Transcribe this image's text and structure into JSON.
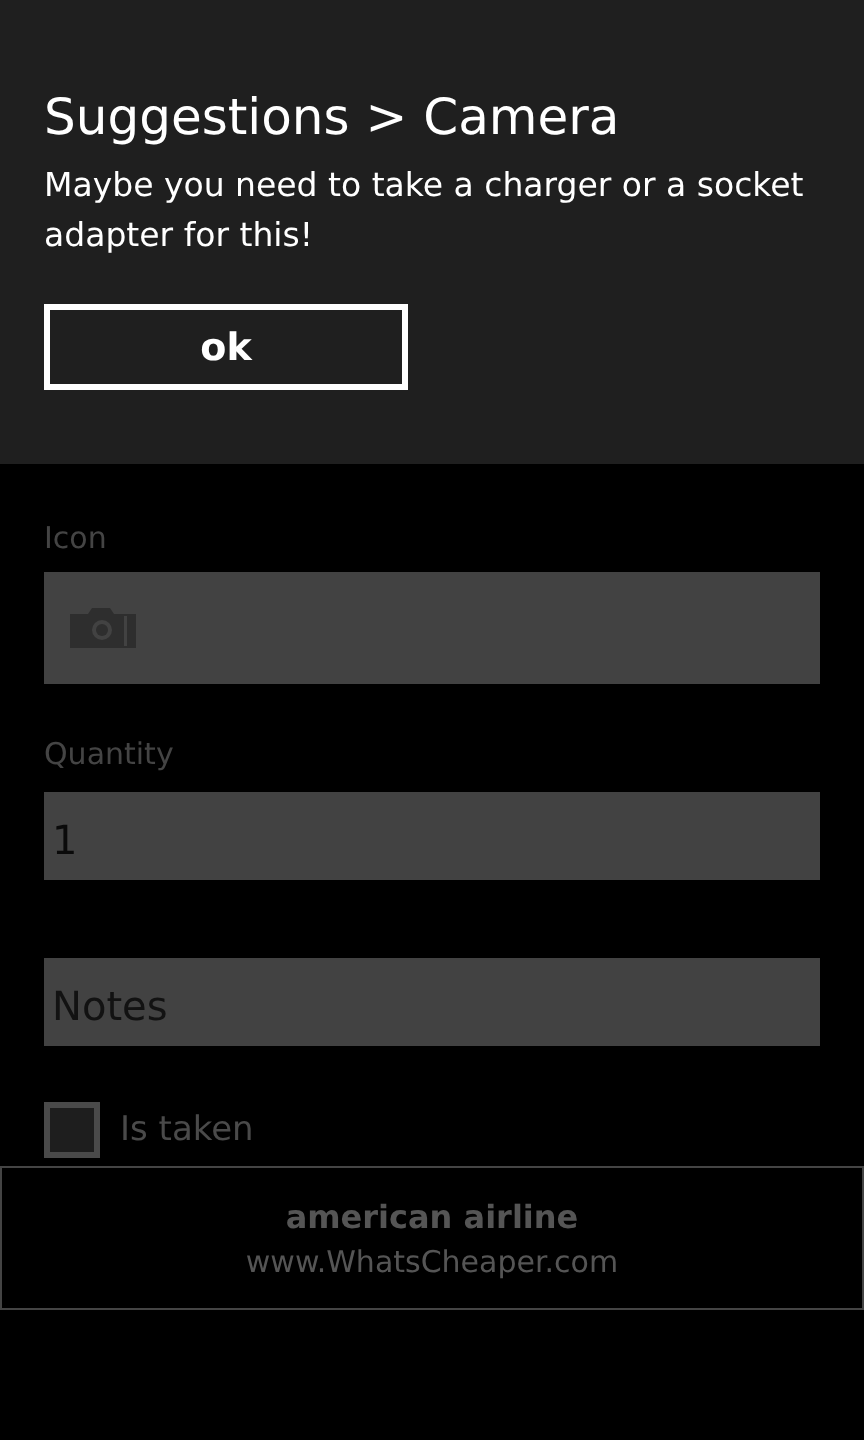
{
  "dialog": {
    "title": "Suggestions > Camera",
    "message": "Maybe you need to take a charger or a socket adapter for this!",
    "button": "ok"
  },
  "form": {
    "icon_label": "Icon",
    "quantity_label": "Quantity",
    "quantity_value": "1",
    "notes_placeholder": "Notes",
    "is_taken": {
      "label": "Is taken",
      "checked": false
    }
  },
  "ad": {
    "title": "american airline",
    "url": "www.WhatsCheaper.com"
  }
}
